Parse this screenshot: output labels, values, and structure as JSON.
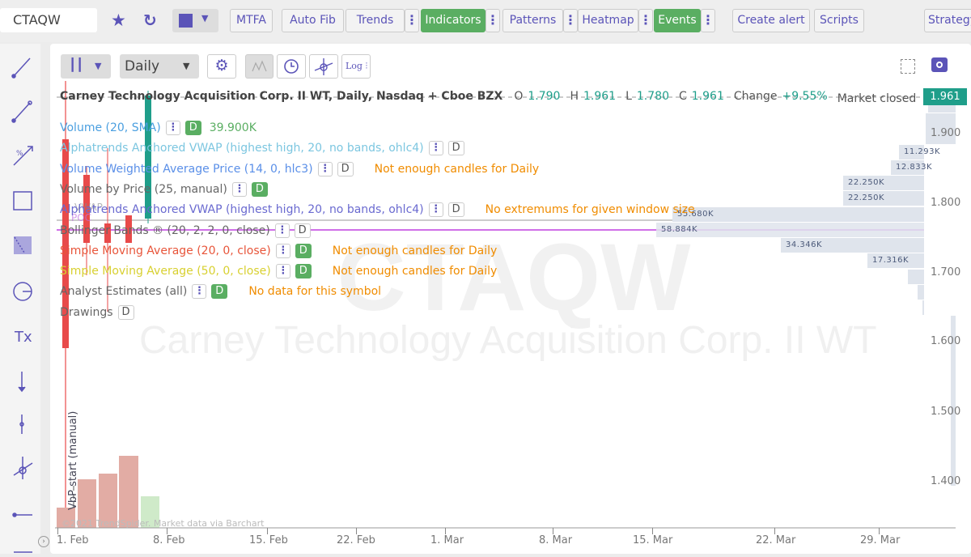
{
  "toolbar": {
    "symbol": "CTAQW",
    "buttons": {
      "mtfa": "MTFA",
      "autofib": "Auto Fib",
      "trends": "Trends",
      "indicators": "Indicators",
      "patterns": "Patterns",
      "heatmap": "Heatmap",
      "events": "Events",
      "create_alert": "Create alert",
      "scripts": "Scripts",
      "strategy": "Strategy"
    },
    "more": "⋮",
    "accent": "#5b54b8",
    "active_color": "#5aae62"
  },
  "chart_toolbar": {
    "interval": "Daily",
    "log": "Log"
  },
  "header": {
    "title": "Carney Technology Acquisition Corp. II WT, Daily, Nasdaq + Cboe BZX",
    "o_label": "O",
    "o": "1.790",
    "h_label": "H",
    "h": "1.961",
    "l_label": "L",
    "l": "1.780",
    "c_label": "C",
    "c": "1.961",
    "change_label": "Change",
    "change": "+9.55%",
    "status": "Market closed",
    "last_price": "1.961"
  },
  "legend": [
    {
      "name": "Volume (20, SMA)",
      "color": "#4a9fe0",
      "badge": "D",
      "value": "39.900K",
      "value_color": "#5aae62"
    },
    {
      "name": "Alphatrends Anchored VWAP (highest high, 20, no bands, ohlc4)",
      "color": "#7cc6e0",
      "badge": "D",
      "outline": true
    },
    {
      "name": "Volume Weighted Average Price (14, 0, hlc3)",
      "color": "#5a8fe8",
      "badge": "D",
      "outline": true,
      "warning": "Not enough candles for Daily"
    },
    {
      "name": "Volume by Price (25, manual)",
      "color": "#666",
      "badge": "D"
    },
    {
      "name": "Alphatrends Anchored VWAP (highest high, 20, no bands, ohlc4)",
      "color": "#6a6ad0",
      "badge": "D",
      "outline": true,
      "warning": "No extremums for given window size"
    },
    {
      "name": "Bollinger Bands ® (20, 2, 2, 0, close)",
      "color": "#666",
      "badge": "D",
      "outline": true
    },
    {
      "name": "Simple Moving Average (20, 0, close)",
      "color": "#e8553a",
      "badge": "D",
      "warning": "Not enough candles for Daily"
    },
    {
      "name": "Simple Moving Average (50, 0, close)",
      "color": "#d8d030",
      "badge": "D",
      "warning": "Not enough candles for Daily"
    },
    {
      "name": "Analyst Estimates (all)",
      "color": "#666",
      "badge": "D",
      "warning": "No data for this symbol"
    },
    {
      "name": "Drawings",
      "color": "#666",
      "badge": "D",
      "outline": true,
      "nomenu": true
    }
  ],
  "watermark": {
    "symbol": "CTAQW",
    "company": "Carney Technology Acquisition Corp. II WT"
  },
  "price_axis": [
    "1.900",
    "1.800",
    "1.700",
    "1.600",
    "1.500",
    "1.400"
  ],
  "date_axis": [
    "1. Feb",
    "8. Feb",
    "15. Feb",
    "22. Feb",
    "1. Mar",
    "8. Mar",
    "15. Mar",
    "22. Mar",
    "29. Mar"
  ],
  "volume_profile": [
    "11.293K",
    "12.833K",
    "22.250K",
    "22.250K",
    "55.680K",
    "58.884K",
    "34.346K",
    "17.316K"
  ],
  "annotations": {
    "vbp_start": "VbP start (manual)",
    "poc": "POC",
    "vwap": "VWAP",
    "copyright": "©2021 TrendSpider. Market data via Barchart"
  }
}
